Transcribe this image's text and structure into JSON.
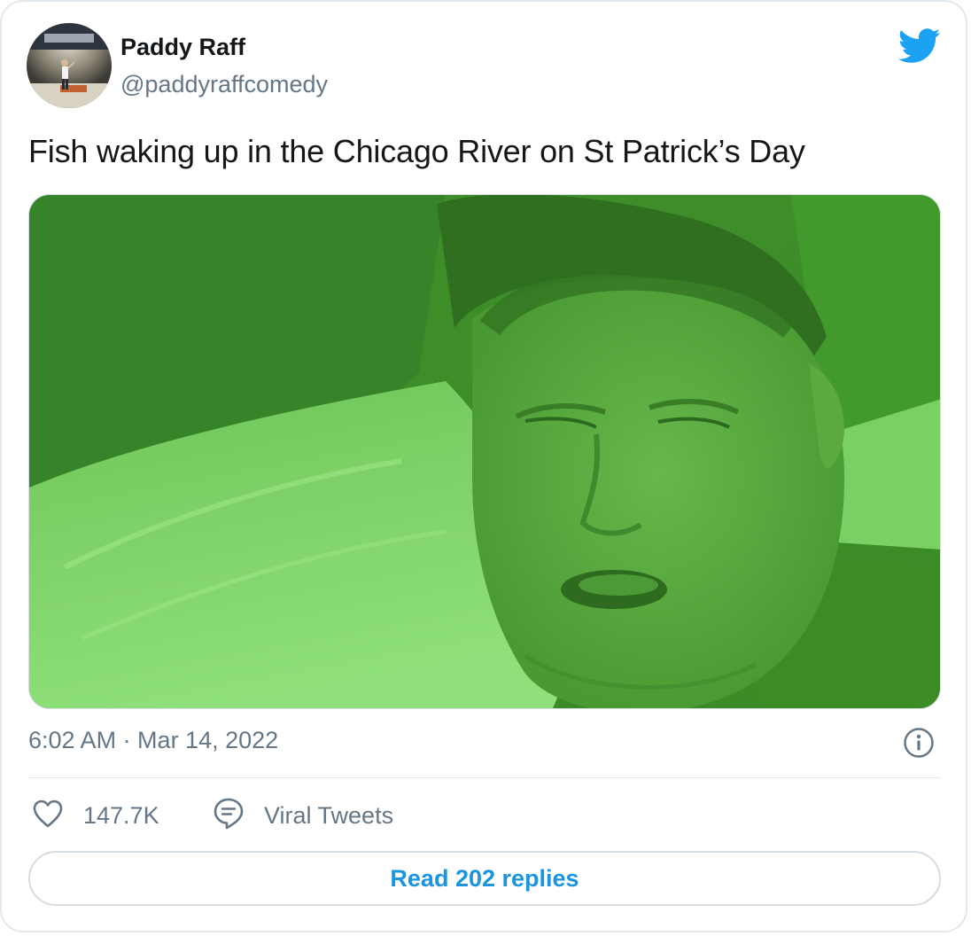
{
  "author": {
    "name": "Paddy Raff",
    "handle": "@paddyraffcomedy",
    "avatar_icon": "comedian-on-stage-avatar"
  },
  "brand": {
    "icon": "twitter-bird-icon",
    "color": "#1da1f2"
  },
  "tweet": {
    "text": "Fish waking up in the Chicago River on St Patrick’s Day",
    "media_icon": "green-tinted-photo-man-waking-on-pillow"
  },
  "meta": {
    "timestamp": "6:02 AM · Mar 14, 2022",
    "info_icon": "info-icon"
  },
  "actions": {
    "likes_count": "147.7K",
    "like_icon": "heart-icon",
    "viral_label": "Viral Tweets",
    "viral_icon": "speech-bubble-icon"
  },
  "replies": {
    "button_label": "Read 202 replies"
  },
  "colors": {
    "text_primary": "#14171a",
    "text_secondary": "#657786",
    "link_blue": "#1b95e0",
    "border": "#e1e8ed",
    "media_green": "#4caf2a"
  }
}
